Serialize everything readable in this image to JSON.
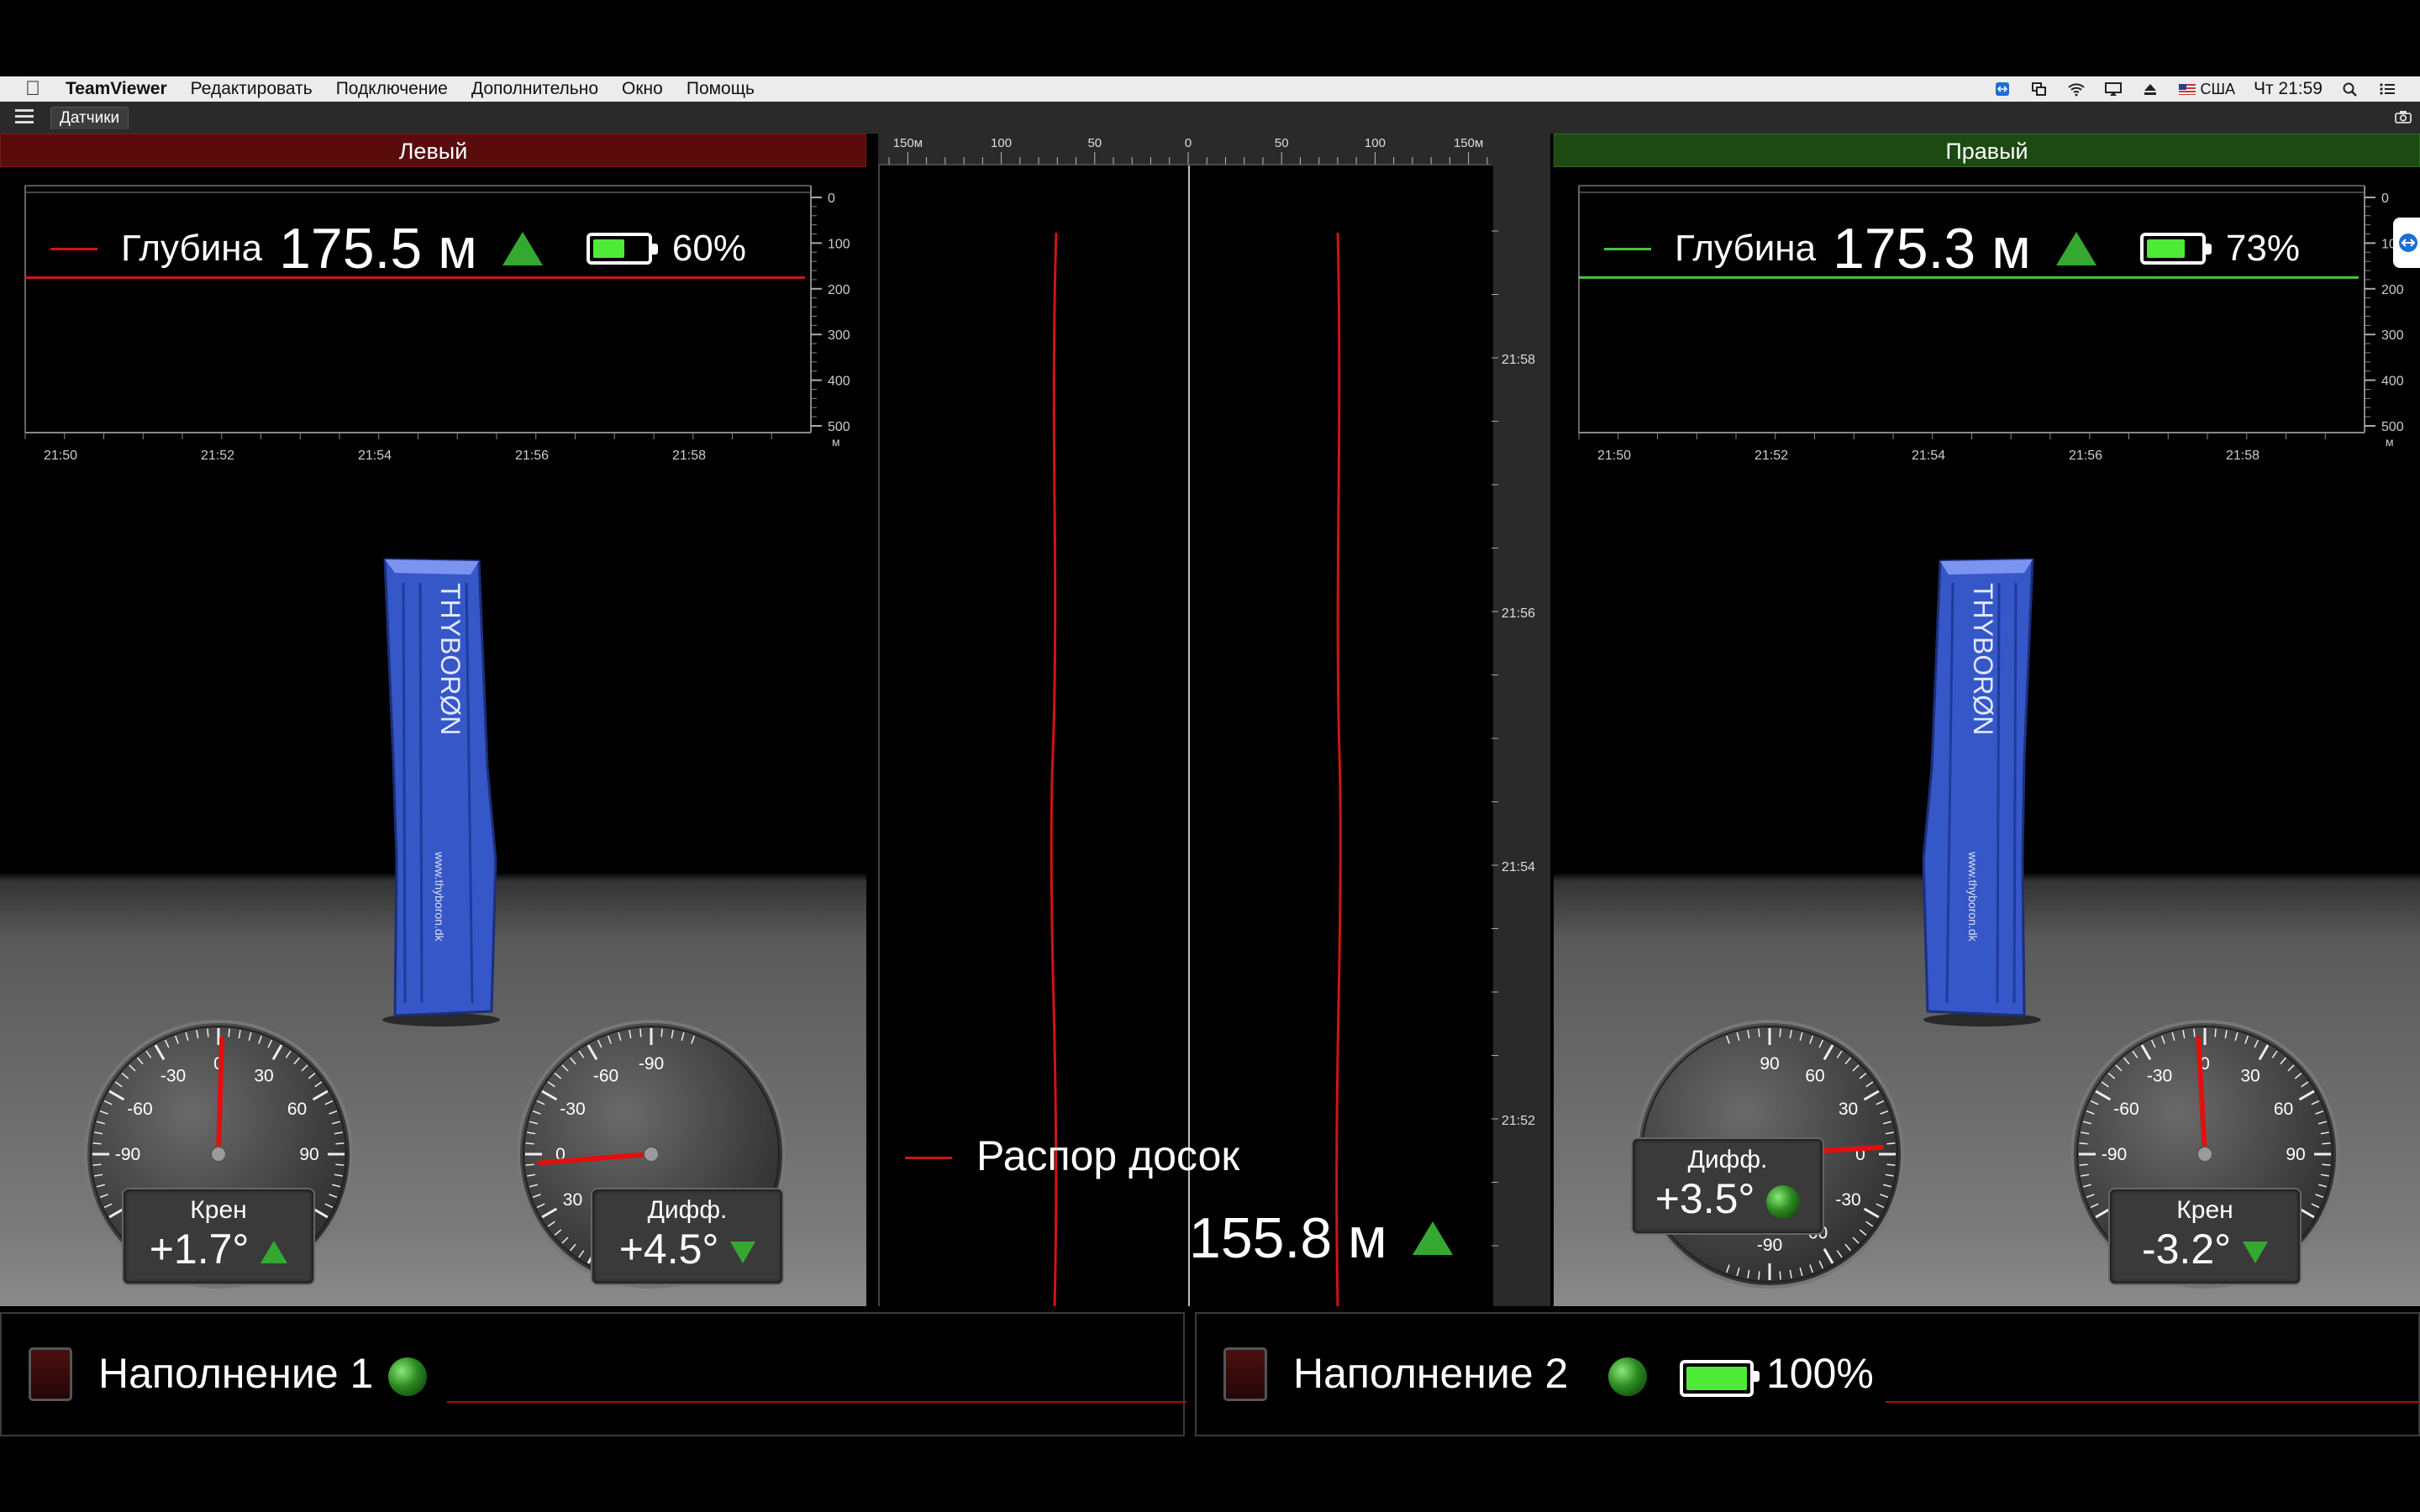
{
  "menubar": {
    "app_name": "TeamViewer",
    "items": [
      "Редактировать",
      "Подключение",
      "Дополнительно",
      "Окно",
      "Помощь"
    ],
    "locale": "США",
    "clock": "Чт 21:59"
  },
  "toolbar": {
    "tab_label": "Датчики"
  },
  "left": {
    "header": "Левый",
    "header_color": "#5a0c0c",
    "line_color": "#d01414",
    "depth_label": "Глубина",
    "depth_value": "175.5 м",
    "depth_level": 175.5,
    "battery_text": "60%",
    "battery_level": 0.6,
    "y_ticks": [
      "0",
      "100",
      "200",
      "300",
      "400",
      "500"
    ],
    "y_unit": "м",
    "x_ticks": [
      "21:50",
      "21:52",
      "21:54",
      "21:56",
      "21:58"
    ],
    "roll": {
      "label": "Крен",
      "value": "+1.7°",
      "trend": "up",
      "angle": 1.7
    },
    "diff": {
      "label": "Дифф.",
      "value": "+4.5°",
      "trend": "down",
      "angle": 4.5
    },
    "gauge_roll_ticks": [
      "-30",
      "0",
      "30",
      "-60",
      "60",
      "-90",
      "90"
    ],
    "gauge_diff_ticks": [
      "90",
      "60",
      "30",
      "0",
      "-30",
      "-60",
      "-90"
    ]
  },
  "right": {
    "header": "Правый",
    "header_color": "#1c4a12",
    "line_color": "#45c83a",
    "depth_label": "Глубина",
    "depth_value": "175.3 м",
    "depth_level": 175.3,
    "battery_text": "73%",
    "battery_level": 0.73,
    "y_ticks": [
      "0",
      "100",
      "200",
      "300",
      "400",
      "500"
    ],
    "y_unit": "м",
    "x_ticks": [
      "21:50",
      "21:52",
      "21:54",
      "21:56",
      "21:58"
    ],
    "roll": {
      "label": "Крен",
      "value": "-3.2°",
      "trend": "down",
      "angle": -3.2
    },
    "diff": {
      "label": "Дифф.",
      "value": "+3.5°",
      "trend": "neutral",
      "angle": 3.5
    },
    "gauge_roll_ticks": [
      "-30",
      "0",
      "30",
      "-60",
      "60",
      "-90",
      "90"
    ],
    "gauge_diff_ticks": [
      "90",
      "60",
      "30",
      "0",
      "-30",
      "-60",
      "-90"
    ]
  },
  "center": {
    "top_ticks": [
      "150м",
      "100",
      "50",
      "0",
      "50",
      "100",
      "150м"
    ],
    "time_ticks": [
      "21:58",
      "21:56",
      "21:54",
      "21:52"
    ],
    "legend_label": "Распор досок",
    "spread_value": "155.8 м",
    "line_color": "#d01414"
  },
  "bottom": {
    "fill1_label": "Наполнение 1",
    "fill2_label": "Наполнение 2",
    "fill2_battery_text": "100%",
    "fill2_battery_level": 1.0
  },
  "logo_text": "THYBORØN",
  "logo_url": "www.thyboron.dk"
}
